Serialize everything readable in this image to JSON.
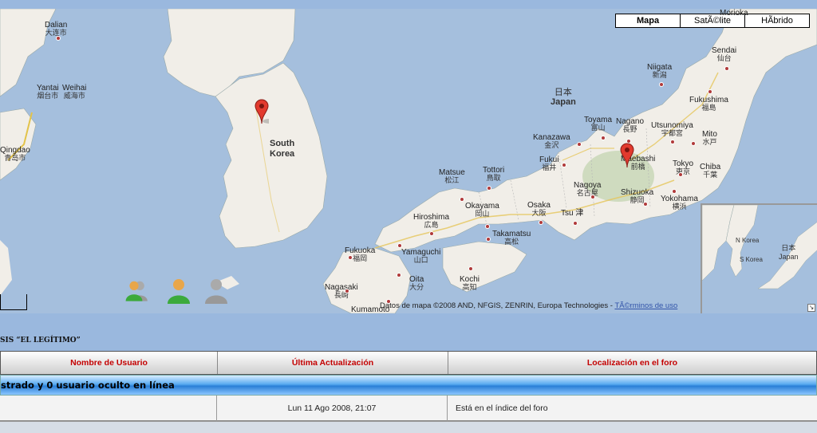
{
  "map": {
    "types": [
      {
        "label": "Mapa",
        "active": true
      },
      {
        "label": "SatÃ©lite",
        "active": false
      },
      {
        "label": "HÃ­brido",
        "active": false
      }
    ],
    "countries": {
      "south_korea": "South\nKorea",
      "japan_jp": "日本",
      "japan_en": "Japan"
    },
    "cities": {
      "dalian": "Dalian",
      "dalian_jp": "大连市",
      "yantai": "Yantai",
      "yantai_jp": "烟台市",
      "weihai": "Weihai",
      "weihai_jp": "威海市",
      "qingdao": "Qingdao",
      "qingdao_jp": "青岛市",
      "morioka": "Morioka",
      "sendai": "Sendai",
      "sendai_jp": "仙台",
      "niigata": "Niigata",
      "niigata_jp": "新潟",
      "fukushima": "Fukushima",
      "fukushima_jp": "福島",
      "toyama": "Toyama",
      "toyama_jp": "富山",
      "nagano": "Nagano",
      "nagano_jp": "長野",
      "utsunomiya": "Utsunomiya",
      "utsunomiya_jp": "宇都宮",
      "mito": "Mito",
      "mito_jp": "水戸",
      "kanazawa": "Kanazawa",
      "kanazawa_jp": "金沢",
      "fukui": "Fukui",
      "fukui_jp": "福井",
      "maebashi": "Maebashi",
      "maebashi_jp": "前橋",
      "tokyo": "Tokyo",
      "tokyo_jp": "東京",
      "chiba": "Chiba",
      "chiba_jp": "千葉",
      "matsue": "Matsue",
      "matsue_jp": "松江",
      "tottori": "Tottori",
      "tottori_jp": "鳥取",
      "nagoya": "Nagoya",
      "nagoya_jp": "名古屋",
      "shizuoka": "Shizuoka",
      "shizuoka_jp": "静岡",
      "yokohama": "Yokohama",
      "yokohama_jp": "横浜",
      "okayama": "Okayama",
      "okayama_jp": "岡山",
      "osaka": "Osaka",
      "osaka_jp": "大阪",
      "tsu": "Tsu",
      "tsu_jp": "津",
      "hiroshima": "Hiroshima",
      "hiroshima_jp": "広島",
      "takamatsu": "Takamatsu",
      "takamatsu_jp": "高松",
      "fukuoka": "Fukuoka",
      "fukuoka_jp": "福岡",
      "yamaguchi": "Yamaguchi",
      "yamaguchi_jp": "山口",
      "oita": "Oita",
      "oita_jp": "大分",
      "kochi": "Kochi",
      "kochi_jp": "高知",
      "nagasaki": "Nagasaki",
      "nagasaki_jp": "長崎",
      "kumamoto": "Kumamoto"
    },
    "inset": {
      "north_korea": "N Korea",
      "south_korea": "S Korea",
      "japan_jp": "日本",
      "japan_en": "Japan"
    },
    "copyright": "Datos de mapa ©2008 AND, NFGIS, ZENRIN, Europa Technologies - ",
    "terms_link": "TÃ©rminos de uso"
  },
  "forum": {
    "title": "SIS “EL LEGÍTIMO”",
    "columns": [
      "Nombre de Usuario",
      "Última Actualización",
      "Localización en el foro"
    ],
    "band_text": "strado y 0 usuario oculto en línea",
    "rows": [
      {
        "user": "",
        "updated": "Lun 11 Ago 2008, 21:07",
        "location": "Está en el índice del foro"
      }
    ]
  }
}
